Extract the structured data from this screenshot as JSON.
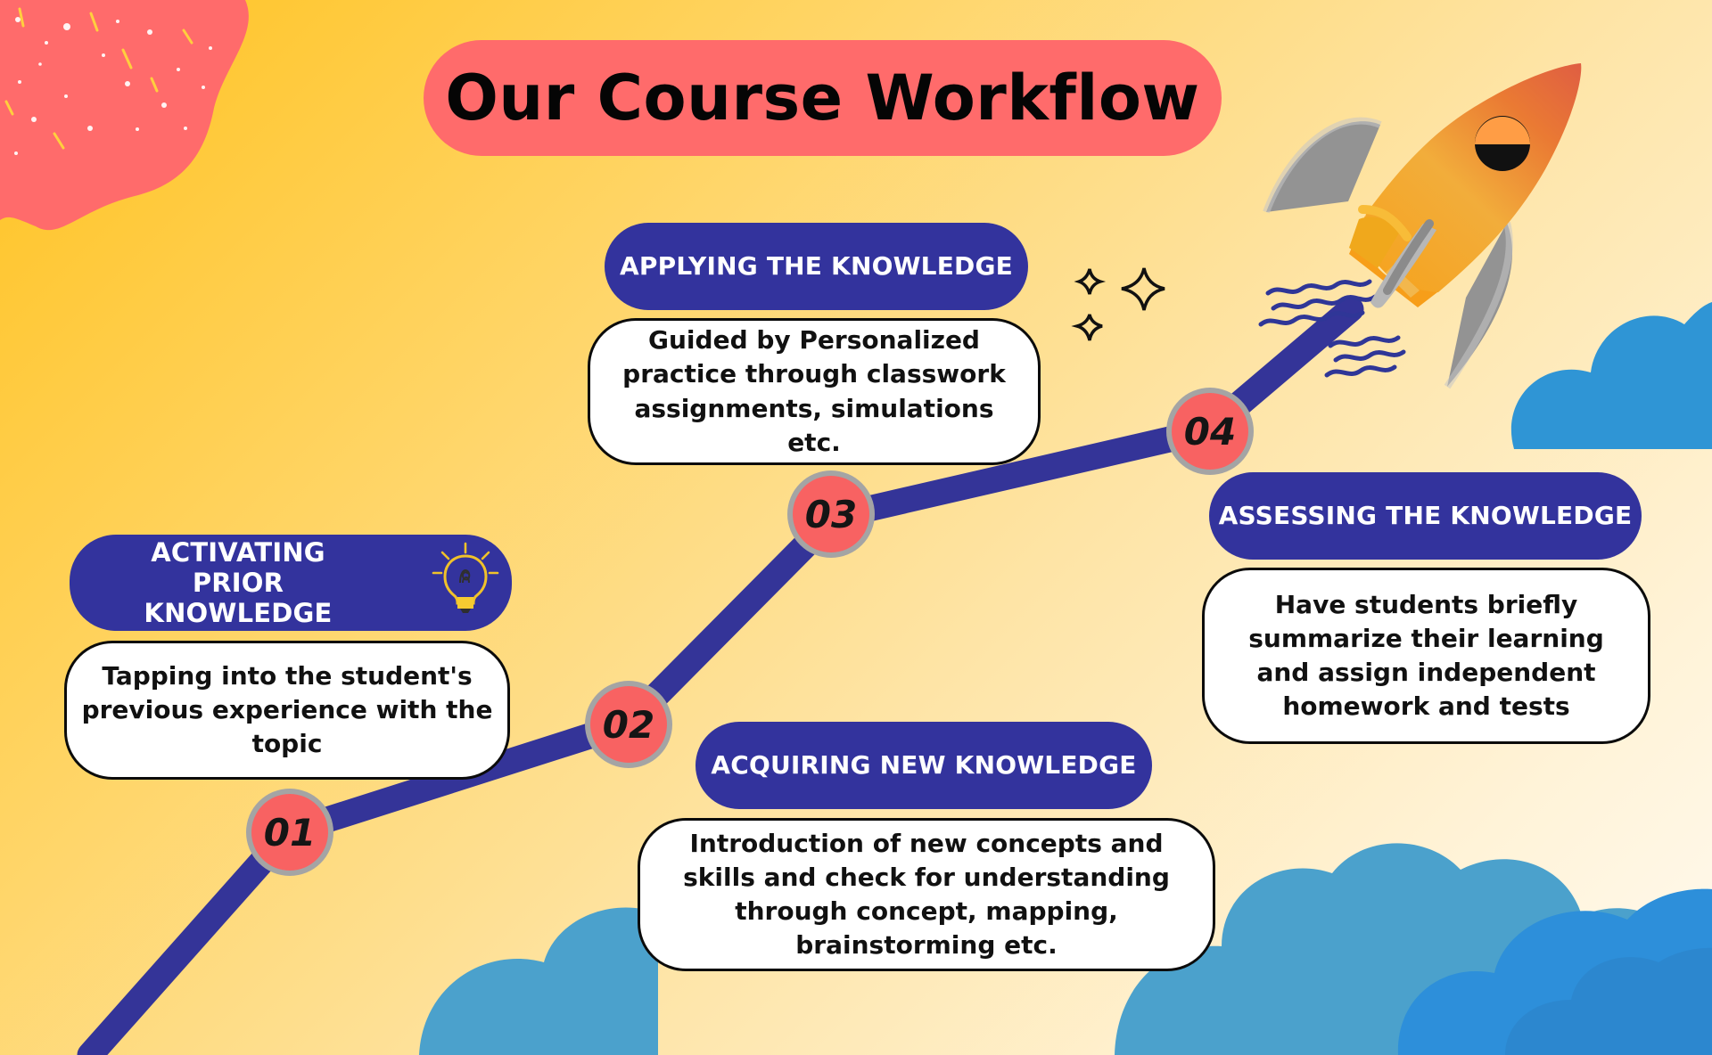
{
  "title": "Our Course Workflow",
  "steps": [
    {
      "number": "01",
      "heading": "ACTIVATING PRIOR KNOWLEDGE",
      "description": "Tapping into the student's previous experience with the topic"
    },
    {
      "number": "02",
      "heading": "ACQUIRING NEW KNOWLEDGE",
      "description": "Introduction of new concepts and skills and check for understanding through concept, mapping, brainstorming etc."
    },
    {
      "number": "03",
      "heading": "APPLYING THE KNOWLEDGE",
      "description": "Guided by Personalized practice through classwork assignments, simulations etc."
    },
    {
      "number": "04",
      "heading": "ASSESSING THE KNOWLEDGE",
      "description": "Have students briefly summarize their learning and assign independent homework and tests"
    }
  ],
  "colors": {
    "title_pill": "#ff6b6b",
    "heading_pill": "#33339d",
    "path": "#343498",
    "node_fill": "#f86262",
    "node_ring": "#9f9f9f",
    "cloud": "#2f95d5"
  },
  "icons": {
    "step_01_icon": "lightbulb-icon",
    "decor": [
      "rocket-icon",
      "sparkle-icon",
      "cloud-icon"
    ]
  }
}
